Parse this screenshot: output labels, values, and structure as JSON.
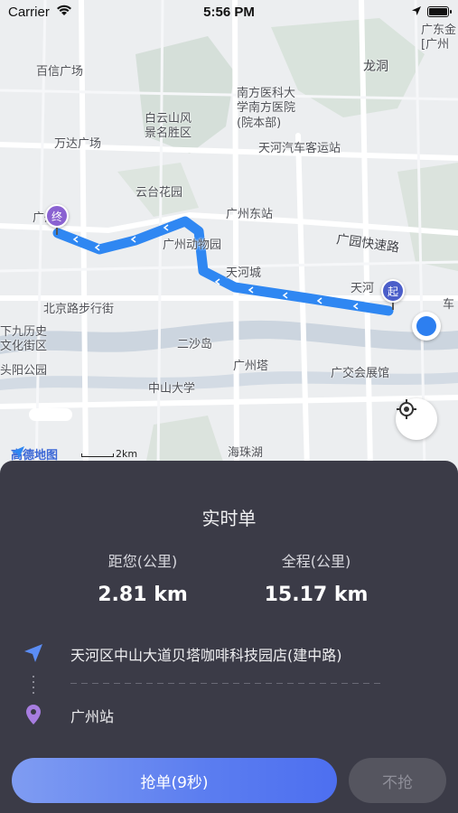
{
  "status_bar": {
    "carrier": "Carrier",
    "time": "5:56 PM"
  },
  "map": {
    "labels": [
      {
        "id": "guangdong",
        "text": "广东金\n[广州"
      },
      {
        "id": "baixin",
        "text": "百信广场"
      },
      {
        "id": "longdong",
        "text": "龙洞"
      },
      {
        "id": "nanfang-univ",
        "text": "南方医科大\n学南方医院\n(院本部)"
      },
      {
        "id": "baiyunshan",
        "text": "白云山风\n景名胜区"
      },
      {
        "id": "wanda",
        "text": "万达广场"
      },
      {
        "id": "tianhe-bus",
        "text": "天河汽车客运站"
      },
      {
        "id": "yuntai",
        "text": "云台花园"
      },
      {
        "id": "gz-east",
        "text": "广州东站"
      },
      {
        "id": "gz-near-end",
        "text": "广州"
      },
      {
        "id": "guangyuan-exp",
        "text": "广园快速路"
      },
      {
        "id": "zoo",
        "text": "广州动物园"
      },
      {
        "id": "tianhecheng",
        "text": "天河城"
      },
      {
        "id": "tianhe-near-start",
        "text": "天河"
      },
      {
        "id": "che",
        "text": "车"
      },
      {
        "id": "beijing-rd",
        "text": "北京路步行街"
      },
      {
        "id": "xiajiu",
        "text": "下九历史\n文化街区"
      },
      {
        "id": "ersha",
        "text": "二沙岛"
      },
      {
        "id": "tou-park",
        "text": "头阳公园"
      },
      {
        "id": "canton-tower",
        "text": "广州塔"
      },
      {
        "id": "expo",
        "text": "广交会展馆"
      },
      {
        "id": "sysu",
        "text": "中山大学"
      },
      {
        "id": "haizhu-lake",
        "text": "海珠湖"
      }
    ],
    "start_pin": "起",
    "end_pin": "终",
    "logo_text": "高德地图",
    "scale_text": "2km",
    "route_color": "#2f87f2"
  },
  "order": {
    "title": "实时单",
    "distance_to_you_label": "距您(公里)",
    "distance_to_you_value": "2.81 km",
    "total_label": "全程(公里)",
    "total_value": "15.17 km",
    "from_address": "天河区中山大道贝塔咖啡科技园店(建中路)",
    "to_address": "广州站",
    "grab_button": "抢单(9秒)",
    "skip_button": "不抢",
    "from_icon": "navigation-arrow-icon",
    "to_icon": "location-pin-icon"
  },
  "colors": {
    "sheet_bg": "#3b3b47",
    "accent_blue": "#5b7df0",
    "from_icon": "#5b8df5",
    "to_icon": "#a77de0"
  }
}
